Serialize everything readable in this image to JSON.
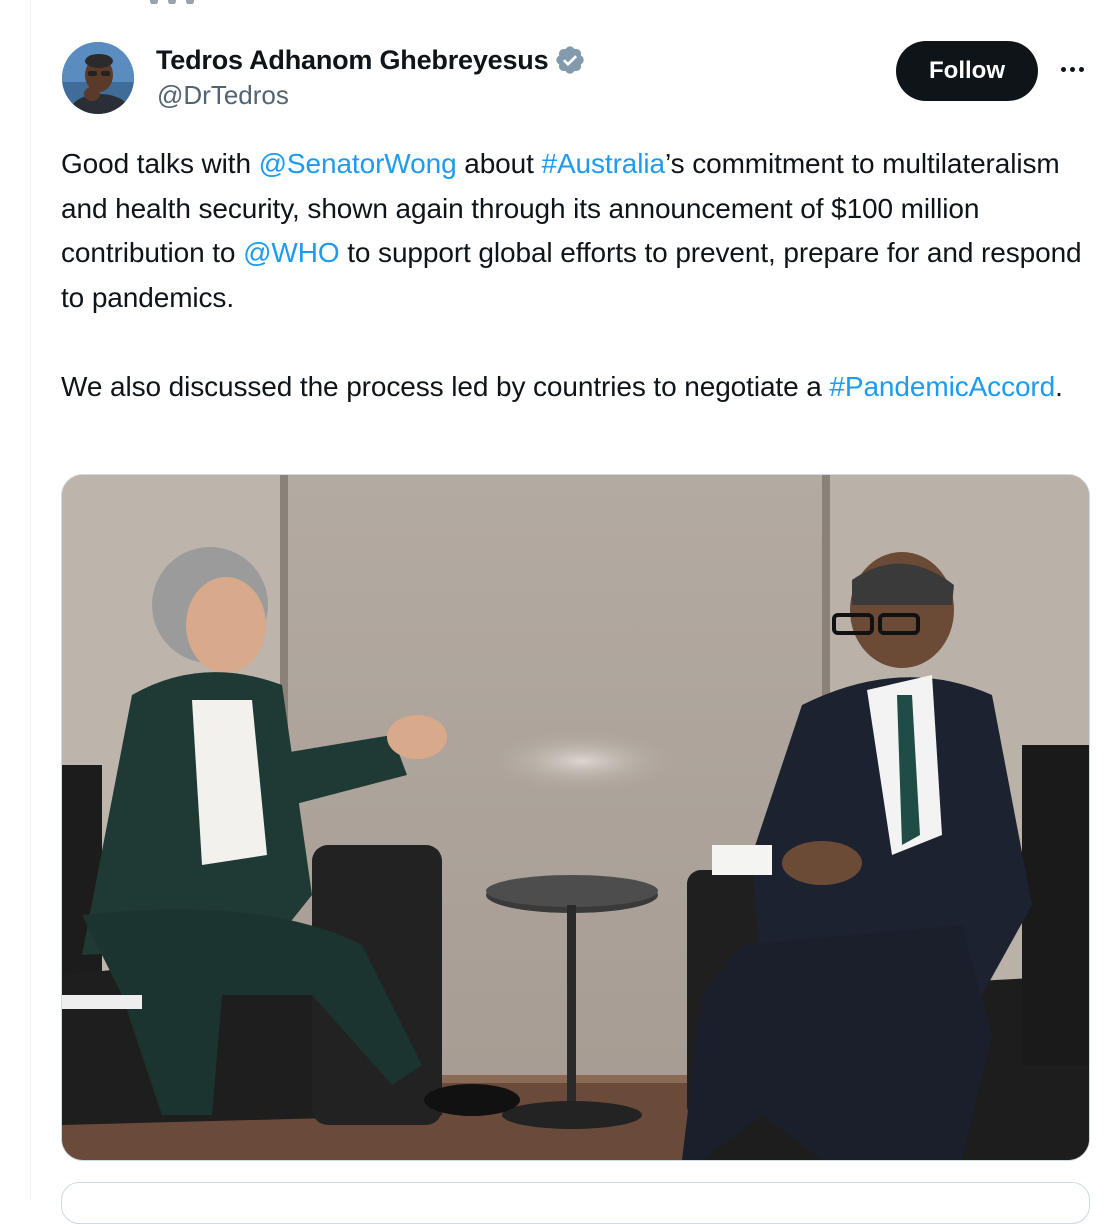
{
  "author": {
    "display_name": "Tedros Adhanom Ghebreyesus",
    "handle": "@DrTedros",
    "verified": true,
    "avatar_icon": "profile-photo"
  },
  "actions": {
    "follow_label": "Follow",
    "more_icon": "more-horizontal-icon"
  },
  "tweet": {
    "p1": {
      "t1": "Good talks with ",
      "m1": "@SenatorWong",
      "t2": " about ",
      "h1": "#Australia",
      "t3": "’s commitment to multilateralism and health security, shown again through its announcement of $100 million contribution to ",
      "m2": "@WHO",
      "t4": " to support global efforts to prevent, prepare for and respond to pandemics."
    },
    "p2": {
      "t1": "We also discussed the process led by countries to negotiate a ",
      "h1": "#PandemicAccord",
      "t2": "."
    }
  },
  "colors": {
    "link": "#1d9bf0",
    "text": "#0f1419",
    "secondary": "#536471",
    "follow_bg": "#0f1419",
    "verified": "#829aab"
  }
}
